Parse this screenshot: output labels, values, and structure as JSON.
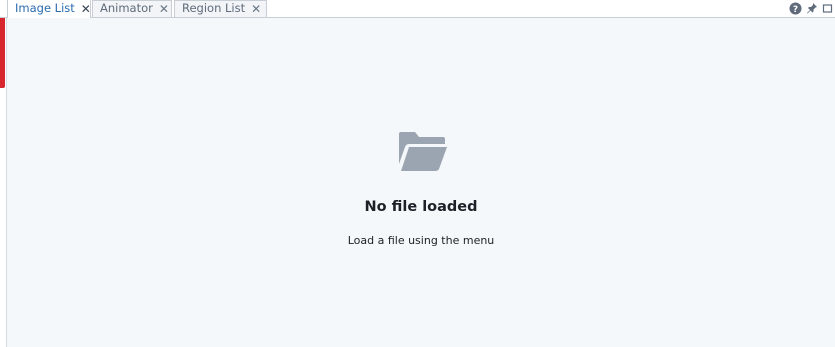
{
  "tabs": [
    {
      "label": "Image List",
      "active": true
    },
    {
      "label": "Animator",
      "active": false
    },
    {
      "label": "Region List",
      "active": false
    }
  ],
  "tab_close_glyph": "✕",
  "window_controls": [
    "help-icon",
    "pin-icon",
    "maximize-icon"
  ],
  "empty_state": {
    "icon": "folder-open-icon",
    "title": "No file loaded",
    "description": "Load a file using the menu"
  },
  "colors": {
    "accent": "#2b6cb0",
    "brand_strip": "#d7262d",
    "panel_bg": "#f5f8fa",
    "icon_gray": "#9aa5b1"
  }
}
